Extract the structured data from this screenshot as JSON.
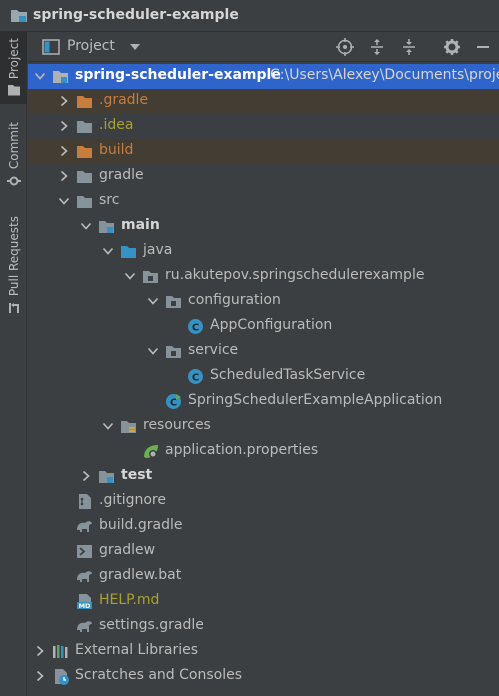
{
  "window": {
    "title": "spring-scheduler-example"
  },
  "side_tabs": {
    "project": "Project",
    "commit": "Commit",
    "pull_requests": "Pull Requests"
  },
  "panel": {
    "title": "Project"
  },
  "tree": {
    "root_name": "spring-scheduler-example",
    "root_path": "C:\\Users\\Alexey\\Documents\\projec",
    "items": [
      "spring-scheduler-example",
      ".gradle",
      ".idea",
      "build",
      "gradle",
      "src",
      "main",
      "java",
      "ru.akutepov.springschedulerexample",
      "configuration",
      "AppConfiguration",
      "service",
      "ScheduledTaskService",
      "SpringSchedulerExampleApplication",
      "resources",
      "application.properties",
      "test",
      ".gitignore",
      "build.gradle",
      "gradlew",
      "gradlew.bat",
      "HELP.md",
      "settings.gradle",
      "External Libraries",
      "Scratches and Consoles"
    ]
  },
  "colors": {
    "selection": "#2f65ca",
    "excluded": "#443d33",
    "excluded_text": "#c77d3c",
    "help_text": "#a9a12f",
    "background": "#3c3f41"
  }
}
